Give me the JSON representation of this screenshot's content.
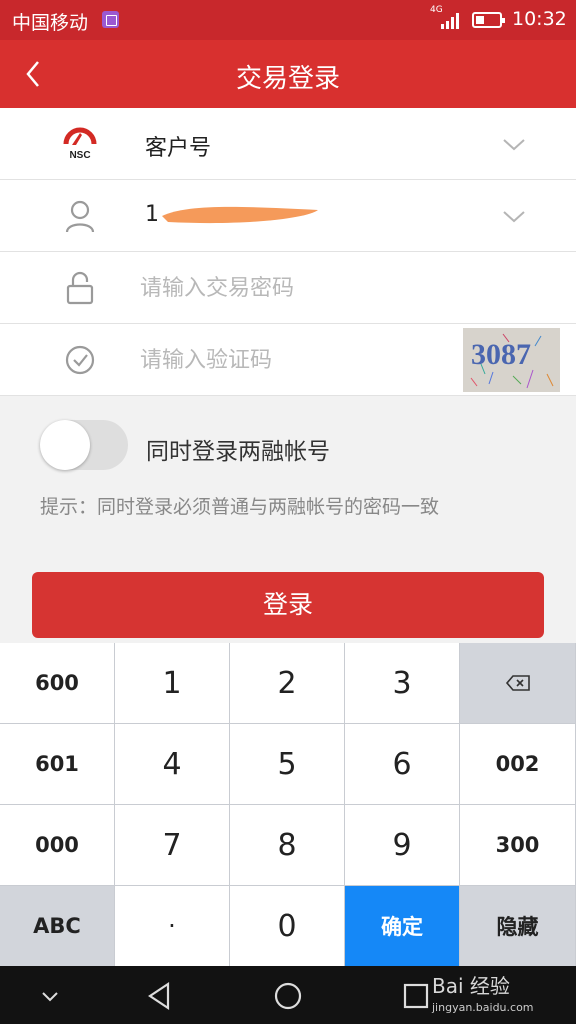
{
  "status_bar": {
    "carrier": "中国移动",
    "network": "4G",
    "time": "10:32"
  },
  "title_bar": {
    "title": "交易登录",
    "back_icon": "chevron-left-icon"
  },
  "form": {
    "broker": {
      "logo_text": "NSC",
      "label": "客户号"
    },
    "account": {
      "value": "1"
    },
    "password": {
      "placeholder": "请输入交易密码"
    },
    "captcha": {
      "placeholder": "请输入验证码",
      "image_text": "3087"
    }
  },
  "margin_switch": {
    "label": "同时登录两融帐号",
    "on": false
  },
  "hint": "提示：同时登录必须普通与两融帐号的密码一致",
  "login_button": "登录",
  "keyboard": {
    "rows": [
      [
        "600",
        "1",
        "2",
        "3",
        "⌫"
      ],
      [
        "601",
        "4",
        "5",
        "6",
        "002"
      ],
      [
        "000",
        "7",
        "8",
        "9",
        "300"
      ],
      [
        "ABC",
        "·",
        "0",
        "确定",
        "隐藏"
      ]
    ]
  },
  "watermark": {
    "brand": "Bai 经验",
    "url": "jingyan.baidu.com"
  },
  "colors": {
    "brand_red": "#d8302f",
    "confirm_blue": "#1588f7"
  }
}
